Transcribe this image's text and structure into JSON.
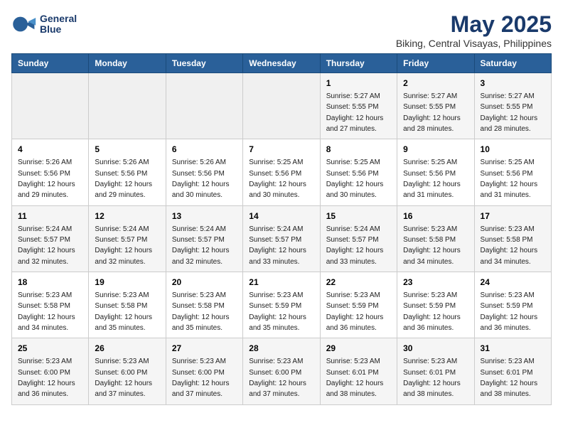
{
  "logo": {
    "line1": "General",
    "line2": "Blue"
  },
  "title": "May 2025",
  "subtitle": "Biking, Central Visayas, Philippines",
  "days_of_week": [
    "Sunday",
    "Monday",
    "Tuesday",
    "Wednesday",
    "Thursday",
    "Friday",
    "Saturday"
  ],
  "weeks": [
    [
      {
        "day": "",
        "info": ""
      },
      {
        "day": "",
        "info": ""
      },
      {
        "day": "",
        "info": ""
      },
      {
        "day": "",
        "info": ""
      },
      {
        "day": "1",
        "info": "Sunrise: 5:27 AM\nSunset: 5:55 PM\nDaylight: 12 hours and 27 minutes."
      },
      {
        "day": "2",
        "info": "Sunrise: 5:27 AM\nSunset: 5:55 PM\nDaylight: 12 hours and 28 minutes."
      },
      {
        "day": "3",
        "info": "Sunrise: 5:27 AM\nSunset: 5:55 PM\nDaylight: 12 hours and 28 minutes."
      }
    ],
    [
      {
        "day": "4",
        "info": "Sunrise: 5:26 AM\nSunset: 5:56 PM\nDaylight: 12 hours and 29 minutes."
      },
      {
        "day": "5",
        "info": "Sunrise: 5:26 AM\nSunset: 5:56 PM\nDaylight: 12 hours and 29 minutes."
      },
      {
        "day": "6",
        "info": "Sunrise: 5:26 AM\nSunset: 5:56 PM\nDaylight: 12 hours and 30 minutes."
      },
      {
        "day": "7",
        "info": "Sunrise: 5:25 AM\nSunset: 5:56 PM\nDaylight: 12 hours and 30 minutes."
      },
      {
        "day": "8",
        "info": "Sunrise: 5:25 AM\nSunset: 5:56 PM\nDaylight: 12 hours and 30 minutes."
      },
      {
        "day": "9",
        "info": "Sunrise: 5:25 AM\nSunset: 5:56 PM\nDaylight: 12 hours and 31 minutes."
      },
      {
        "day": "10",
        "info": "Sunrise: 5:25 AM\nSunset: 5:56 PM\nDaylight: 12 hours and 31 minutes."
      }
    ],
    [
      {
        "day": "11",
        "info": "Sunrise: 5:24 AM\nSunset: 5:57 PM\nDaylight: 12 hours and 32 minutes."
      },
      {
        "day": "12",
        "info": "Sunrise: 5:24 AM\nSunset: 5:57 PM\nDaylight: 12 hours and 32 minutes."
      },
      {
        "day": "13",
        "info": "Sunrise: 5:24 AM\nSunset: 5:57 PM\nDaylight: 12 hours and 32 minutes."
      },
      {
        "day": "14",
        "info": "Sunrise: 5:24 AM\nSunset: 5:57 PM\nDaylight: 12 hours and 33 minutes."
      },
      {
        "day": "15",
        "info": "Sunrise: 5:24 AM\nSunset: 5:57 PM\nDaylight: 12 hours and 33 minutes."
      },
      {
        "day": "16",
        "info": "Sunrise: 5:23 AM\nSunset: 5:58 PM\nDaylight: 12 hours and 34 minutes."
      },
      {
        "day": "17",
        "info": "Sunrise: 5:23 AM\nSunset: 5:58 PM\nDaylight: 12 hours and 34 minutes."
      }
    ],
    [
      {
        "day": "18",
        "info": "Sunrise: 5:23 AM\nSunset: 5:58 PM\nDaylight: 12 hours and 34 minutes."
      },
      {
        "day": "19",
        "info": "Sunrise: 5:23 AM\nSunset: 5:58 PM\nDaylight: 12 hours and 35 minutes."
      },
      {
        "day": "20",
        "info": "Sunrise: 5:23 AM\nSunset: 5:58 PM\nDaylight: 12 hours and 35 minutes."
      },
      {
        "day": "21",
        "info": "Sunrise: 5:23 AM\nSunset: 5:59 PM\nDaylight: 12 hours and 35 minutes."
      },
      {
        "day": "22",
        "info": "Sunrise: 5:23 AM\nSunset: 5:59 PM\nDaylight: 12 hours and 36 minutes."
      },
      {
        "day": "23",
        "info": "Sunrise: 5:23 AM\nSunset: 5:59 PM\nDaylight: 12 hours and 36 minutes."
      },
      {
        "day": "24",
        "info": "Sunrise: 5:23 AM\nSunset: 5:59 PM\nDaylight: 12 hours and 36 minutes."
      }
    ],
    [
      {
        "day": "25",
        "info": "Sunrise: 5:23 AM\nSunset: 6:00 PM\nDaylight: 12 hours and 36 minutes."
      },
      {
        "day": "26",
        "info": "Sunrise: 5:23 AM\nSunset: 6:00 PM\nDaylight: 12 hours and 37 minutes."
      },
      {
        "day": "27",
        "info": "Sunrise: 5:23 AM\nSunset: 6:00 PM\nDaylight: 12 hours and 37 minutes."
      },
      {
        "day": "28",
        "info": "Sunrise: 5:23 AM\nSunset: 6:00 PM\nDaylight: 12 hours and 37 minutes."
      },
      {
        "day": "29",
        "info": "Sunrise: 5:23 AM\nSunset: 6:01 PM\nDaylight: 12 hours and 38 minutes."
      },
      {
        "day": "30",
        "info": "Sunrise: 5:23 AM\nSunset: 6:01 PM\nDaylight: 12 hours and 38 minutes."
      },
      {
        "day": "31",
        "info": "Sunrise: 5:23 AM\nSunset: 6:01 PM\nDaylight: 12 hours and 38 minutes."
      }
    ]
  ]
}
